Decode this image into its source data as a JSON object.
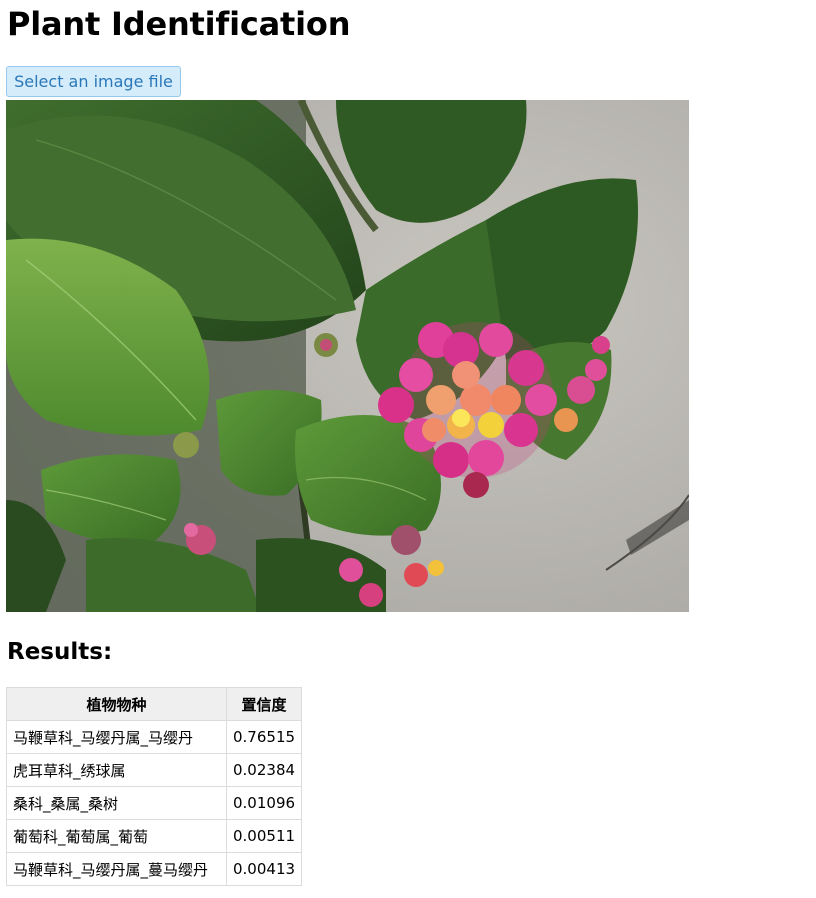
{
  "page": {
    "title": "Plant Identification",
    "select_button_label": "Select an image file",
    "image_alt": "Lantana flower photo",
    "results_heading": "Results:"
  },
  "table": {
    "headers": [
      "植物物种",
      "置信度"
    ],
    "rows": [
      {
        "species": "马鞭草科_马缨丹属_马缨丹",
        "confidence": "0.76515"
      },
      {
        "species": "虎耳草科_绣球属",
        "confidence": "0.02384"
      },
      {
        "species": "桑科_桑属_桑树",
        "confidence": "0.01096"
      },
      {
        "species": "葡萄科_葡萄属_葡萄",
        "confidence": "0.00511"
      },
      {
        "species": "马鞭草科_马缨丹属_蔓马缨丹",
        "confidence": "0.00413"
      }
    ]
  },
  "colors": {
    "button_bg": "#d5ecfb",
    "button_border": "#96c8ec",
    "button_text": "#2a78b8",
    "table_header_bg": "#efefef",
    "table_border": "#dcdcdc"
  }
}
